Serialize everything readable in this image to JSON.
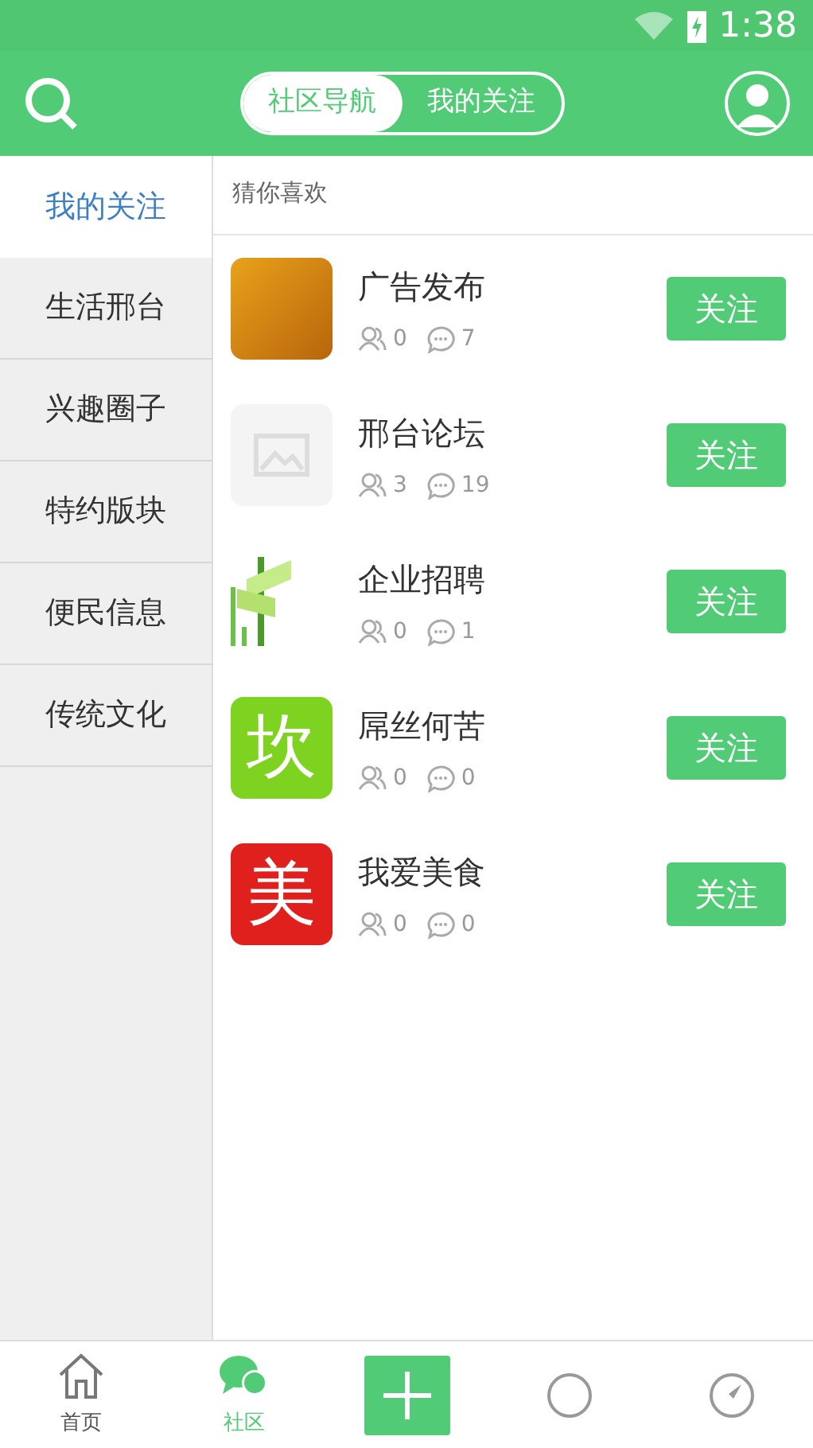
{
  "status_bar": {
    "time": "1:38"
  },
  "header": {
    "segments": [
      {
        "label": "社区导航",
        "selected": true
      },
      {
        "label": "我的关注",
        "selected": false
      }
    ]
  },
  "sidebar": {
    "items": [
      {
        "label": "我的关注",
        "selected": true
      },
      {
        "label": "生活邢台",
        "selected": false
      },
      {
        "label": "兴趣圈子",
        "selected": false
      },
      {
        "label": "特约版块",
        "selected": false
      },
      {
        "label": "便民信息",
        "selected": false
      },
      {
        "label": "传统文化",
        "selected": false
      }
    ]
  },
  "section_title": "猜你喜欢",
  "forums": [
    {
      "name": "广告发布",
      "members": "0",
      "posts": "7",
      "logo": {
        "kind": "photo"
      },
      "button": "关注"
    },
    {
      "name": "邢台论坛",
      "members": "3",
      "posts": "19",
      "logo": {
        "kind": "placeholder"
      },
      "button": "关注"
    },
    {
      "name": "企业招聘",
      "members": "0",
      "posts": "1",
      "logo": {
        "kind": "signpost"
      },
      "button": "关注"
    },
    {
      "name": "屌丝何苦",
      "members": "0",
      "posts": "0",
      "logo": {
        "kind": "glyph",
        "text": "坎",
        "color": "#7ed321"
      },
      "button": "关注"
    },
    {
      "name": "我爱美食",
      "members": "0",
      "posts": "0",
      "logo": {
        "kind": "glyph",
        "text": "美",
        "color": "#e0201c"
      },
      "button": "关注"
    }
  ],
  "bottom_nav": [
    {
      "kind": "home",
      "label": "首页",
      "selected": false
    },
    {
      "kind": "chat",
      "label": "社区",
      "selected": true
    },
    {
      "kind": "add"
    },
    {
      "kind": "circle",
      "selected": false
    },
    {
      "kind": "compass",
      "selected": false
    }
  ]
}
